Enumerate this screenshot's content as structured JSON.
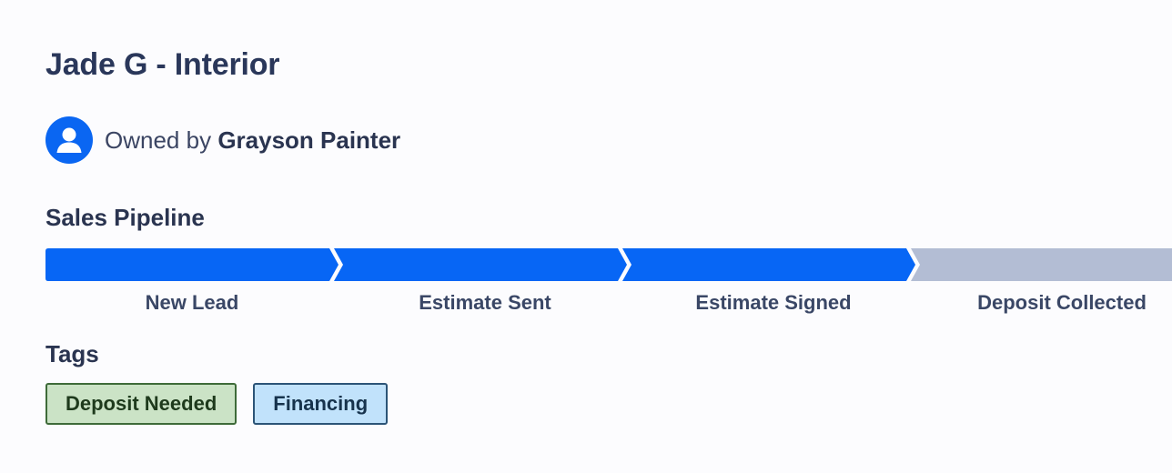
{
  "title": "Jade G - Interior",
  "owner": {
    "prefix": "Owned by",
    "name": "Grayson Painter",
    "avatar_icon": "user-circle-icon",
    "avatar_color": "#0a66f2"
  },
  "pipeline": {
    "label": "Sales Pipeline",
    "completed_color": "#0766f5",
    "pending_color": "#b3bdd4",
    "stages": [
      {
        "label": "New Lead",
        "completed": true
      },
      {
        "label": "Estimate Sent",
        "completed": true
      },
      {
        "label": "Estimate Signed",
        "completed": true
      },
      {
        "label": "Deposit Collected",
        "completed": false
      }
    ]
  },
  "tags": {
    "label": "Tags",
    "items": [
      {
        "label": "Deposit Needed",
        "bg": "#cbe3c6",
        "border": "#3e6b39",
        "color": "#1e3a1c"
      },
      {
        "label": "Financing",
        "bg": "#c1e2fb",
        "border": "#2c5477",
        "color": "#17334d"
      }
    ]
  }
}
